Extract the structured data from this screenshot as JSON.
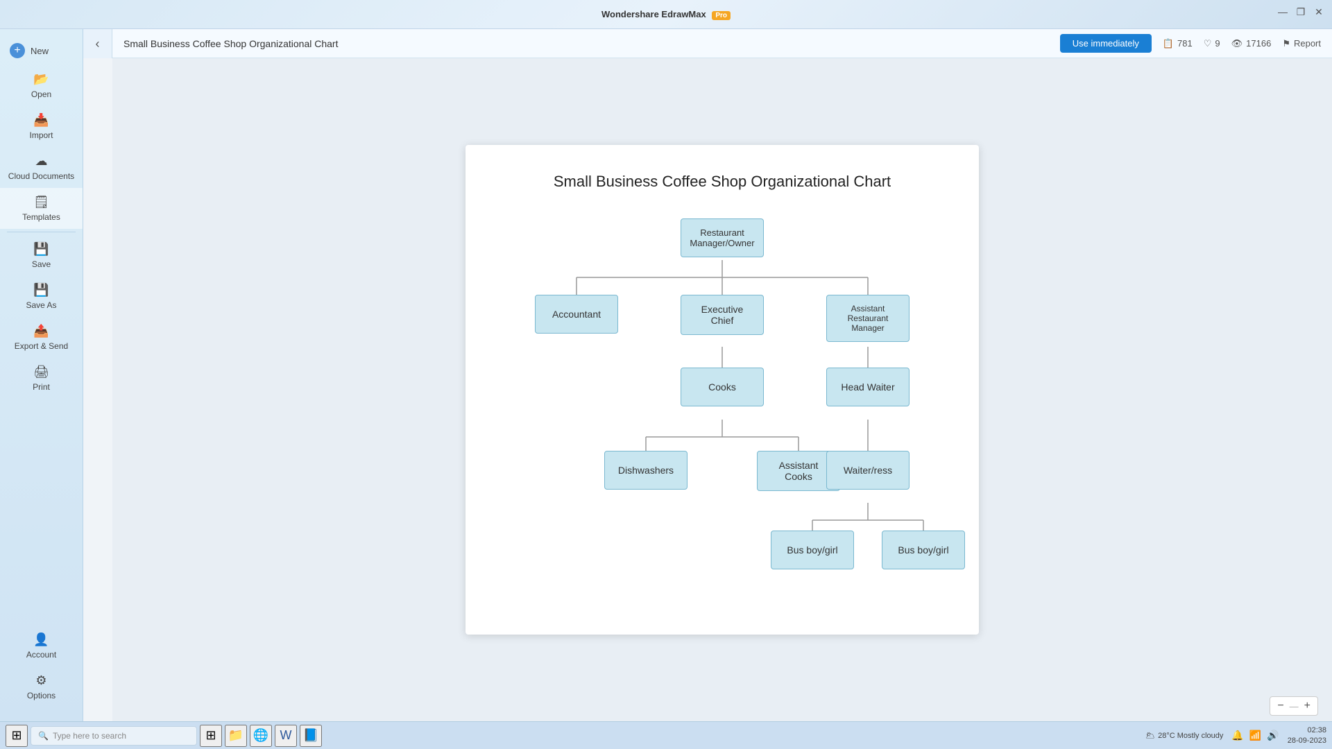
{
  "titlebar": {
    "app_name": "Wondershare EdrawMax",
    "pro_label": "Pro"
  },
  "window_controls": {
    "minimize": "—",
    "maximize": "❐",
    "close": "✕"
  },
  "sidebar": {
    "back_icon": "←",
    "items": [
      {
        "id": "new",
        "label": "New",
        "icon": "📄"
      },
      {
        "id": "open",
        "label": "Open",
        "icon": "📂"
      },
      {
        "id": "import",
        "label": "Import",
        "icon": "📥"
      },
      {
        "id": "cloud",
        "label": "Cloud Documents",
        "icon": "☁"
      },
      {
        "id": "templates",
        "label": "Templates",
        "icon": "🗒"
      },
      {
        "id": "save",
        "label": "Save",
        "icon": "💾"
      },
      {
        "id": "saveas",
        "label": "Save As",
        "icon": "💾"
      },
      {
        "id": "export",
        "label": "Export & Send",
        "icon": "📤"
      },
      {
        "id": "print",
        "label": "Print",
        "icon": "🖨"
      }
    ],
    "bottom_items": [
      {
        "id": "account",
        "label": "Account",
        "icon": "👤"
      },
      {
        "id": "options",
        "label": "Options",
        "icon": "⚙"
      }
    ]
  },
  "header": {
    "back_icon": "‹",
    "title": "Small Business Coffee Shop Organizational Chart",
    "use_immediately": "Use immediately",
    "stats": {
      "copies_icon": "📋",
      "copies": "781",
      "likes_icon": "♡",
      "likes": "9",
      "views_icon": "👁",
      "views": "17166"
    },
    "report_label": "Report",
    "report_icon": "⚑"
  },
  "chart": {
    "title": "Small Business Coffee Shop Organizational Chart",
    "nodes": {
      "root": "Restaurant Manager/Owner",
      "level2": [
        "Accountant",
        "Executive Chief",
        "Assistant Restaurant Manager"
      ],
      "level3_chief": [
        "Cooks"
      ],
      "level3_arm": [
        "Head Waiter"
      ],
      "level4_cooks": [
        "Dishwashers",
        "Assistant Cooks"
      ],
      "level4_hw": [
        "Waiter/ress"
      ],
      "level5_hw": [
        "Bus boy/girl",
        "Bus boy/girl"
      ]
    }
  },
  "zoom": {
    "minus": "−",
    "plus": "+",
    "value": "—"
  },
  "taskbar": {
    "start_icon": "⊞",
    "search_placeholder": "Type here to search",
    "search_icon": "🔍",
    "apps": [
      "⊞",
      "🔍",
      "🌐",
      "📁",
      "W",
      "📘"
    ],
    "weather": "28°C  Mostly cloudy",
    "time": "02:38",
    "date": "28-09-2023"
  }
}
